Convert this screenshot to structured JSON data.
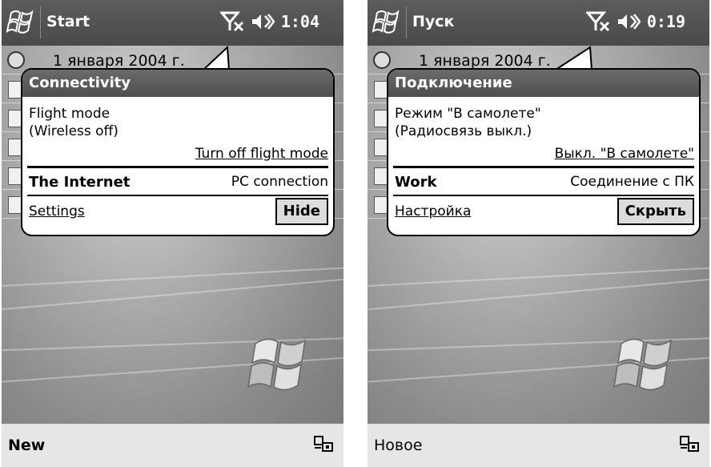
{
  "screens": [
    {
      "title": "Start",
      "time": "1:04",
      "date": "1 января 2004 г.",
      "popup": {
        "header": "Connectivity",
        "status_line1": "Flight mode",
        "status_line2": "(Wireless off)",
        "toggle_link": "Turn off flight mode",
        "connection_name": "The Internet",
        "connection_type": "PC connection",
        "settings_link": "Settings",
        "hide_button": "Hide"
      },
      "menu_left": "New"
    },
    {
      "title": "Пуск",
      "time": "0:19",
      "date": "1 января 2004 г.",
      "popup": {
        "header": "Подключение",
        "status_line1": "Режим \"В самолете\"",
        "status_line2": "(Радиосвязь выкл.)",
        "toggle_link": "Выкл. \"В самолете\"",
        "connection_name": "Work",
        "connection_type": "Соединение с ПК",
        "settings_link": "Настройка",
        "hide_button": "Скрыть"
      },
      "menu_left": "Новое"
    }
  ],
  "icons": {
    "start": "windows-flag-icon",
    "connectivity": "antenna-off-icon",
    "volume": "speaker-icon",
    "input_panel": "keyboard-icon"
  }
}
